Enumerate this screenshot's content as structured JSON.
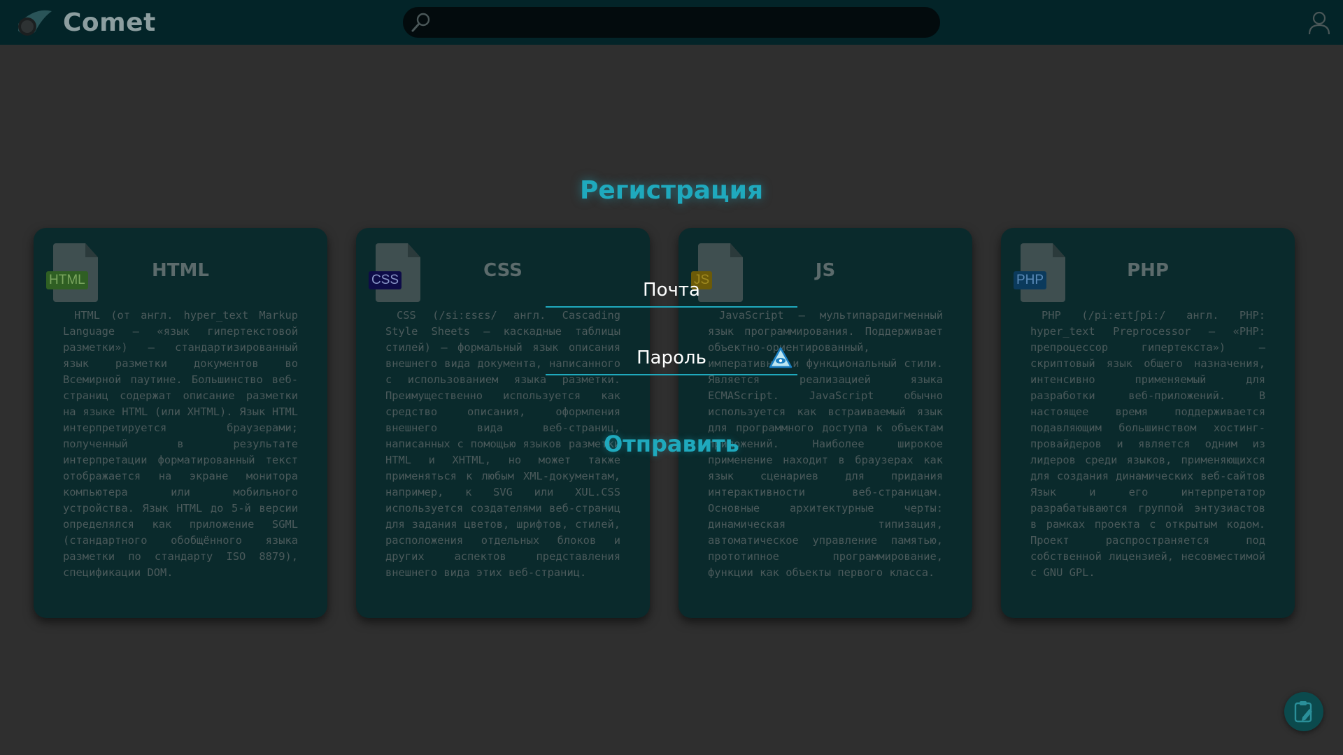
{
  "header": {
    "brand": "Comet",
    "search_placeholder": ""
  },
  "page_title": "Регистрация",
  "form": {
    "email_label": "Почта",
    "password_label": "Пароль",
    "submit_label": "Отправить"
  },
  "cards": [
    {
      "tag": "HTML",
      "tag_bg": "#2f5f23",
      "tag_color": "#7aa55e",
      "title": "HTML",
      "text": "HTML (от англ. hyper_text Markup Language — «язык гипертекстовой разметки») — стандартизированный язык разметки документов во Всемирной паутине. Большинство веб-страниц содержат описание разметки на языке HTML (или XHTML). Язык HTML интерпретируется браузерами; полученный в результате интерпретации форматированный текст отображается на экране монитора компьютера или мобильного устройства. Язык HTML до 5-й версии определялся как приложение SGML (стандартного обобщённого языка разметки по стандарту ISO 8879), спецификации DOM."
    },
    {
      "tag": "CSS",
      "tag_bg": "#0e0c48",
      "tag_color": "#8a96c8",
      "title": "CSS",
      "text": "CSS (/siːɛsɛs/ англ. Cascading Style Sheets — каскадные таблицы стилей) — формальный язык описания внешнего вида документа, написанного с использованием языка разметки. Преимущественно используется как средство описания, оформления внешнего вида веб-страниц, написанных с помощью языков разметки HTML и XHTML, но может также применяться к любым XML-документам, например, к SVG или XUL.CSS используется создателями веб-страниц для задания цветов, шрифтов, стилей, расположения отдельных блоков и других аспектов представления внешнего вида этих веб-страниц."
    },
    {
      "tag": "JS",
      "tag_bg": "#6b5a08",
      "tag_color": "#a08a20",
      "title": "JS",
      "text": "JavaScript — мультипарадигменный язык программирования. Поддерживает объектно-ориентированный, императивный и функциональный стили. Является реализацией языка ECMAScript. JavaScript обычно используется как встраиваемый язык для программного доступа к объектам приложений. Наиболее широкое применение находит в браузерах как язык сценариев для придания интерактивности веб-страницам. Основные архитектурные черты: динамическая типизация, автоматическое управление памятью, прототипное программирование, функции как объекты первого класса."
    },
    {
      "tag": "PHP",
      "tag_bg": "#0b3a5c",
      "tag_color": "#5a8ab8",
      "title": "PHP",
      "text": "PHP (/piːeɪtʃpiː/ англ. PHP: hyper_text Preprocessor — «PHP: препроцессор гипертекста») — скриптовый язык общего назначения, интенсивно применяемый для разработки веб-приложений. В настоящее время поддерживается подавляющим большинством хостинг-провайдеров и является одним из лидеров среди языков, применяющихся для создания динамических веб-сайтов Язык и его интерпретатор разрабатываются группой энтузиастов в рамках проекта с открытым кодом. Проект распространяется под собственной лицензией, несовместимой с GNU GPL."
    }
  ]
}
